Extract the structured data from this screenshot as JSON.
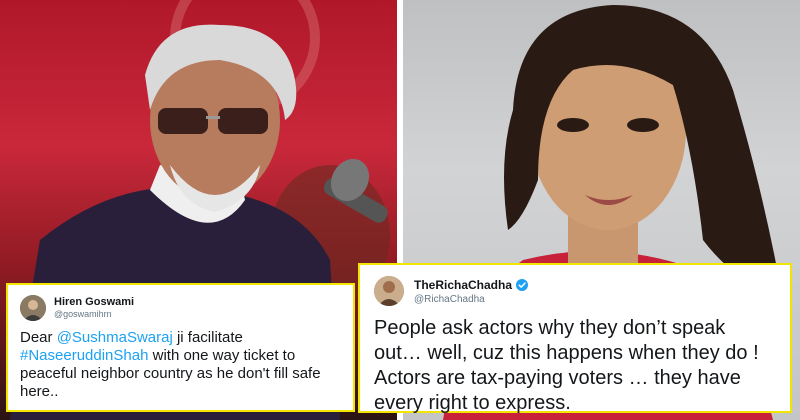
{
  "colors": {
    "tweet_border": "#f2e600",
    "link": "#1da1f2",
    "verified": "#1da1f2"
  },
  "left_tweet": {
    "name": "Hiren Goswami",
    "handle": "@goswamihrn",
    "text_prefix": "Dear ",
    "mention": "@SushmaSwaraj",
    "text_middle": " ji facilitate ",
    "hashtag": "#NaseeruddinShah",
    "text_suffix": " with one way ticket to peaceful neighbor country as he don't fill safe here.."
  },
  "right_tweet": {
    "name": "TheRichaChadha",
    "handle": "@RichaChadha",
    "verified_icon": "verified-badge-icon",
    "text": "People ask actors why they don’t speak out… well, cuz this happens when they do ! Actors are tax-paying voters … they have every right to express."
  }
}
